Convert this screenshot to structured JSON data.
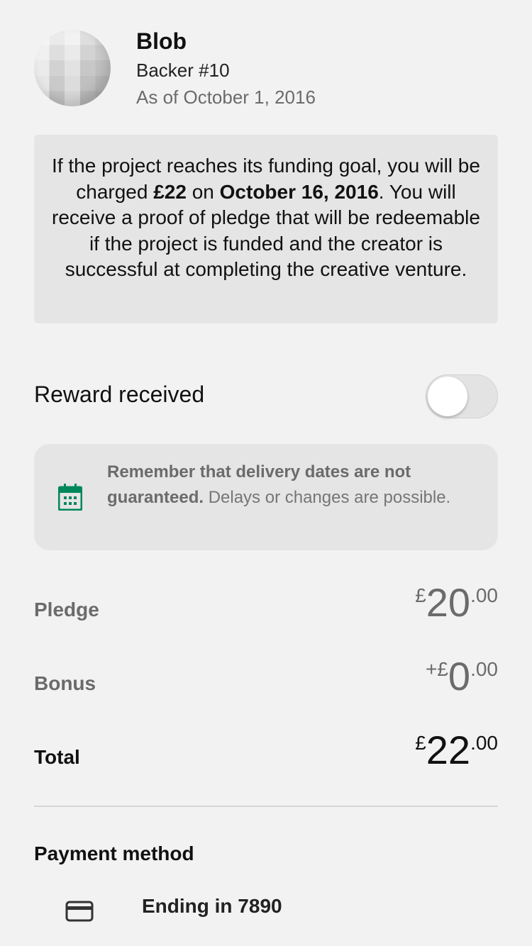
{
  "backer": {
    "name": "Blob",
    "number": "Backer #10",
    "as_of": "As of October 1, 2016"
  },
  "charge_note": {
    "part1": "If the project reaches its funding goal, you will be charged ",
    "amount": "£22",
    "part2": " on ",
    "date": "October 16, 2016",
    "part3": ". You will receive a proof of pledge that will be redeemable if the project is funded and the creator is successful at completing the creative venture."
  },
  "reward": {
    "label": "Reward received",
    "toggle_on": false
  },
  "delivery_note": {
    "bold": "Remember that delivery dates are not guaranteed.",
    "rest": " Delays or changes are possible.",
    "icon": "calendar-icon",
    "icon_color": "#00875a"
  },
  "amounts": {
    "pledge": {
      "label": "Pledge",
      "prefix": "£",
      "whole": "20",
      "cents": ".00"
    },
    "bonus": {
      "label": "Bonus",
      "prefix": "+£",
      "whole": "0",
      "cents": ".00"
    },
    "total": {
      "label": "Total",
      "prefix": "£",
      "whole": "22",
      "cents": ".00"
    }
  },
  "payment": {
    "title": "Payment method",
    "card_text": "Ending in 7890",
    "icon": "credit-card-icon"
  }
}
